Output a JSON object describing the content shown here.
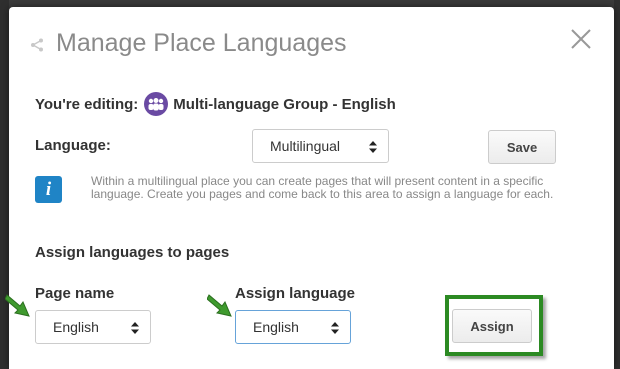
{
  "dialog": {
    "title": "Manage Place Languages",
    "share_icon": "share-icon",
    "close_icon": "close-icon"
  },
  "editing": {
    "prefix": "You're editing:",
    "group_icon": "group-people-icon",
    "group_name": "Multi-language Group - English"
  },
  "language": {
    "label": "Language:",
    "selected": "Multilingual",
    "save_label": "Save"
  },
  "info": {
    "icon": "info-icon",
    "glyph": "i",
    "text": "Within a multilingual place you can create pages that will present content in a specific language. Create you pages and come back to this area to assign a language for each."
  },
  "assign": {
    "heading": "Assign languages to pages",
    "page_name_label": "Page name",
    "page_name_selected": "English",
    "assign_language_label": "Assign language",
    "assign_language_selected": "English",
    "assign_button_label": "Assign"
  },
  "colors": {
    "accent_blue": "#1f84c6",
    "highlight_green": "#2c8a23",
    "avatar_purple": "#6a4aa3"
  }
}
